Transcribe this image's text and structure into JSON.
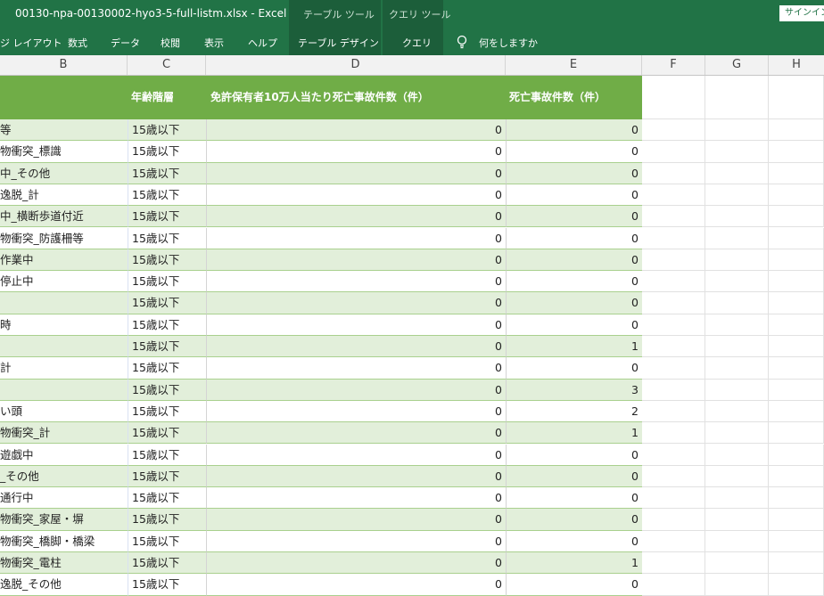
{
  "window": {
    "title": "00130-npa-00130002-hyo3-5-full-listm.xlsx  -  Excel",
    "context_tabs": [
      "テーブル ツール",
      "クエリ ツール"
    ],
    "signin_label": "サインイン"
  },
  "ribbon": {
    "tabs": [
      "ジ レイアウト",
      "数式",
      "データ",
      "校閲",
      "表示",
      "ヘルプ",
      "テーブル デザイン",
      "クエリ"
    ],
    "tell_me": "何をしますか"
  },
  "columns": [
    "B",
    "C",
    "D",
    "E",
    "F",
    "G",
    "H"
  ],
  "table": {
    "headers": [
      "",
      "年齢階層",
      "免許保有者10万人当たり死亡事故件数（件）",
      "死亡事故件数（件）"
    ],
    "rows": [
      [
        "等",
        "15歳以下",
        "0",
        "0"
      ],
      [
        "物衝突_標識",
        "15歳以下",
        "0",
        "0"
      ],
      [
        "中_その他",
        "15歳以下",
        "0",
        "0"
      ],
      [
        "逸脱_計",
        "15歳以下",
        "0",
        "0"
      ],
      [
        "中_横断歩道付近",
        "15歳以下",
        "0",
        "0"
      ],
      [
        "物衝突_防護柵等",
        "15歳以下",
        "0",
        "0"
      ],
      [
        "作業中",
        "15歳以下",
        "0",
        "0"
      ],
      [
        "停止中",
        "15歳以下",
        "0",
        "0"
      ],
      [
        "",
        "15歳以下",
        "0",
        "0"
      ],
      [
        "時",
        "15歳以下",
        "0",
        "0"
      ],
      [
        "",
        "15歳以下",
        "0",
        "1"
      ],
      [
        "計",
        "15歳以下",
        "0",
        "0"
      ],
      [
        "",
        "15歳以下",
        "0",
        "3"
      ],
      [
        "い頭",
        "15歳以下",
        "0",
        "2"
      ],
      [
        "物衝突_計",
        "15歳以下",
        "0",
        "1"
      ],
      [
        "遊戯中",
        "15歳以下",
        "0",
        "0"
      ],
      [
        "_その他",
        "15歳以下",
        "0",
        "0"
      ],
      [
        "通行中",
        "15歳以下",
        "0",
        "0"
      ],
      [
        "物衝突_家屋・塀",
        "15歳以下",
        "0",
        "0"
      ],
      [
        "物衝突_橋脚・橋梁",
        "15歳以下",
        "0",
        "0"
      ],
      [
        "物衝突_電柱",
        "15歳以下",
        "0",
        "1"
      ],
      [
        "逸脱_その他",
        "15歳以下",
        "0",
        "0"
      ]
    ]
  }
}
